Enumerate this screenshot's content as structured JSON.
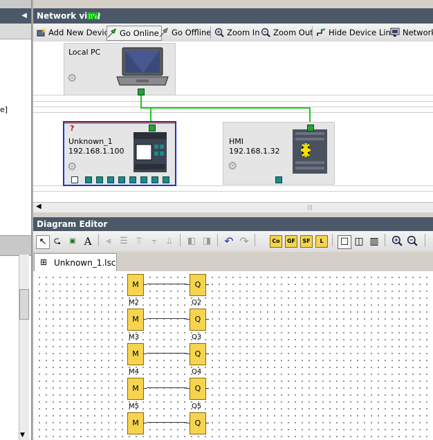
{
  "left_pane": {
    "fragment_text": "e]"
  },
  "network_view": {
    "title": "Network view",
    "toolbar": {
      "add_device": "Add New Device",
      "go_online": "Go Online",
      "go_offline": "Go Offline",
      "zoom_in": "Zoom In",
      "zoom_out": "Zoom Out",
      "hide_device_line": "Hide Device Line",
      "network": "Network"
    },
    "devices": {
      "local_pc": {
        "name": "Local PC"
      },
      "unknown": {
        "badge": "?",
        "name": "Unknown_1",
        "ip": "192.168.1.100"
      },
      "hmi": {
        "name": "HMI",
        "ip": "192.168.1.32"
      }
    },
    "colors": {
      "link": "#1ec81e",
      "selection": "#1a2fe0",
      "accent": "#f07820"
    }
  },
  "diagram_editor": {
    "title": "Diagram Editor",
    "tab": {
      "label": "Unknown_1.lsc"
    },
    "function_buttons": [
      "Co",
      "GF",
      "SF",
      "L"
    ],
    "blocks": [
      {
        "in": "M",
        "out": "Q",
        "in_label": "M2",
        "out_label": "Q2"
      },
      {
        "in": "M",
        "out": "Q",
        "in_label": "M3",
        "out_label": "Q3"
      },
      {
        "in": "M",
        "out": "Q",
        "in_label": "M4",
        "out_label": "Q4"
      },
      {
        "in": "M",
        "out": "Q",
        "in_label": "M5",
        "out_label": "Q5"
      },
      {
        "in": "M",
        "out": "Q",
        "in_label": "",
        "out_label": ""
      }
    ]
  }
}
